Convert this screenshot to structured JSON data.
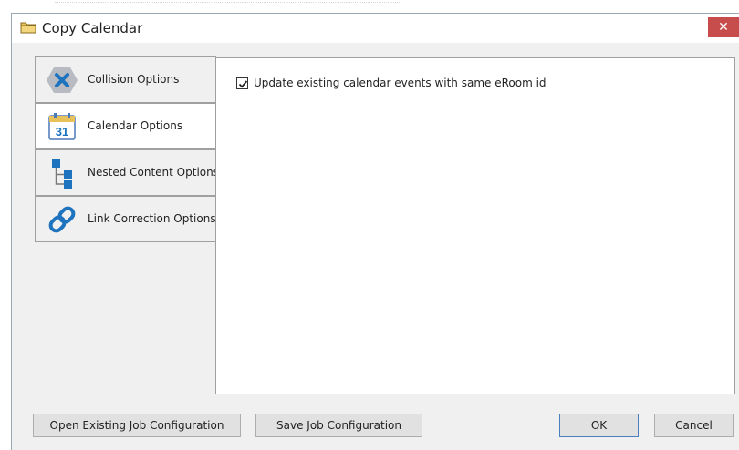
{
  "window": {
    "title": "Copy Calendar",
    "close_label": "✕",
    "title_icon": "folder-icon"
  },
  "tabs": [
    {
      "label": "Collision Options",
      "icon": "collision-x-icon",
      "selected": false
    },
    {
      "label": "Calendar Options",
      "icon": "calendar-icon",
      "icon_text": "31",
      "selected": true
    },
    {
      "label": "Nested Content Options",
      "icon": "tree-hierarchy-icon",
      "selected": false
    },
    {
      "label": "Link Correction Options",
      "icon": "chain-link-icon",
      "selected": false
    }
  ],
  "calendar_options": {
    "update_existing": {
      "label": "Update existing calendar events with same eRoom id",
      "checked": true
    }
  },
  "footer": {
    "open_config": "Open Existing Job Configuration",
    "save_config": "Save Job Configuration",
    "ok": "OK",
    "cancel": "Cancel"
  },
  "colors": {
    "close_button": "#c74c4c",
    "dialog_bg": "#f0f0f0",
    "accent_blue": "#1e73be"
  }
}
